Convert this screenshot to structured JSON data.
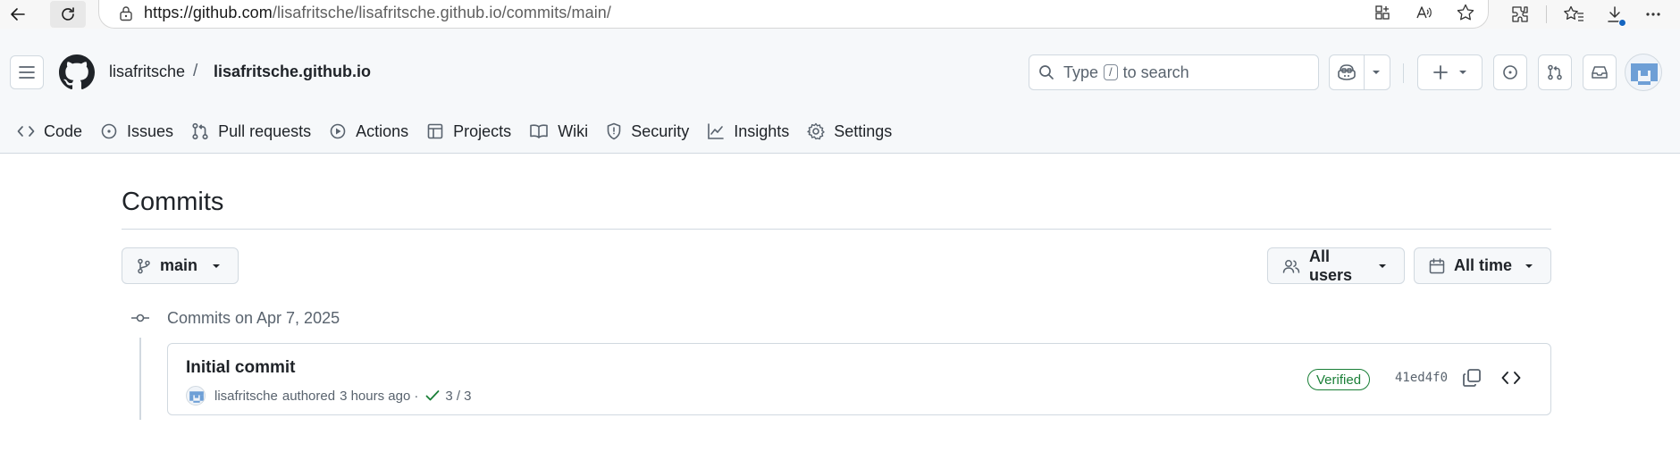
{
  "browser": {
    "url_host": "https://github.com",
    "url_path": "/lisafritsche/lisafritsche.github.io/commits/main/",
    "icons": [
      "back-icon",
      "reload-icon",
      "lock-icon",
      "app-available-icon",
      "read-aloud-icon",
      "favorite-icon",
      "extensions-icon",
      "favorites-icon",
      "downloads-icon",
      "more-icon"
    ]
  },
  "header": {
    "owner": "lisafritsche",
    "separator": "/",
    "repo": "lisafritsche.github.io",
    "search": {
      "prefix": "Type",
      "key": "/",
      "suffix": "to search"
    }
  },
  "repo_nav": [
    {
      "label": "Code",
      "icon": "code-icon"
    },
    {
      "label": "Issues",
      "icon": "issue-icon"
    },
    {
      "label": "Pull requests",
      "icon": "pull-request-icon"
    },
    {
      "label": "Actions",
      "icon": "play-icon"
    },
    {
      "label": "Projects",
      "icon": "table-icon"
    },
    {
      "label": "Wiki",
      "icon": "book-icon"
    },
    {
      "label": "Security",
      "icon": "shield-icon"
    },
    {
      "label": "Insights",
      "icon": "graph-icon"
    },
    {
      "label": "Settings",
      "icon": "gear-icon"
    }
  ],
  "main": {
    "title": "Commits",
    "branch": "main",
    "users_filter": "All users",
    "time_filter": "All time",
    "group_label": "Commits on Apr 7, 2025",
    "commit": {
      "message": "Initial commit",
      "author": "lisafritsche",
      "authored": "authored",
      "time": "3 hours ago",
      "dot": "·",
      "checks": "3 / 3",
      "badge": "Verified",
      "sha": "41ed4f0"
    }
  },
  "colors": {
    "header_bg": "#f6f8fa",
    "border": "#d1d9e0",
    "success": "#1a7f37",
    "muted": "#59636e",
    "fg": "#1f2328"
  }
}
